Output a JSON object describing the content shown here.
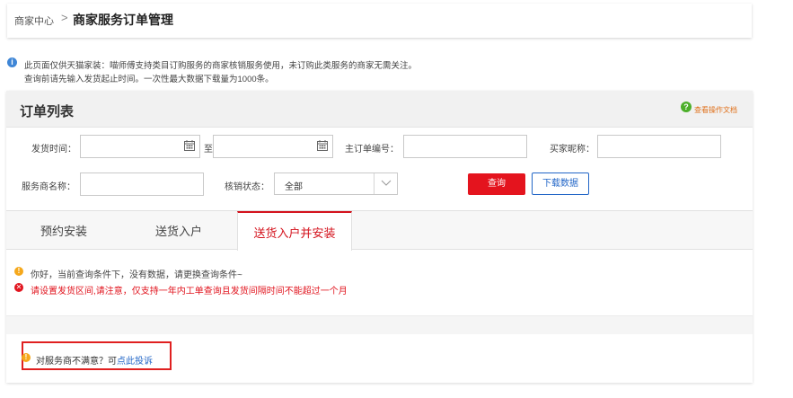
{
  "breadcrumb": {
    "home": "商家中心",
    "separator": ">",
    "title": "商家服务订单管理"
  },
  "notice": {
    "line1": "此页面仅供天猫家装：喵师傅支持类目订购服务的商家核销服务使用，未订购此类服务的商家无需关注。",
    "line2": "查询前请先输入发货起止时间。一次性最大数据下载量为1000条。"
  },
  "panel": {
    "title": "订单列表",
    "help_link": "查看操作文档"
  },
  "filters": {
    "ship_time_label": "发货时间：",
    "ship_time_from": "",
    "to_label": "至",
    "ship_time_to": "",
    "main_order_label": "主订单编号：",
    "main_order_value": "",
    "buyer_label": "买家昵称：",
    "buyer_value": "",
    "provider_label": "服务商名称：",
    "provider_value": "",
    "status_label": "核销状态：",
    "status_value": "全部",
    "query_button": "查询",
    "download_button": "下载数据"
  },
  "tabs": [
    {
      "label": "预约安装",
      "active": false
    },
    {
      "label": "送货入户",
      "active": false
    },
    {
      "label": "送货入户并安装",
      "active": true
    }
  ],
  "messages": {
    "warning": "你好，当前查询条件下，没有数据，请更换查询条件~",
    "error": "请设置发货区间,请注意，仅支持一年内工单查询且发货间隔时间不能超过一个月"
  },
  "complaint": {
    "text": "对服务商不满意？可",
    "link": "点此投诉"
  },
  "colors": {
    "accent_red": "#e4141e",
    "link_blue": "#2266c7",
    "help_orange": "#e0711c",
    "warn_yellow": "#f5a81c"
  },
  "icons": {
    "info": "info-icon",
    "help": "question-icon",
    "calendar": "calendar-icon",
    "dropdown": "chevron-down-icon",
    "warning": "warning-icon",
    "error": "error-icon"
  }
}
